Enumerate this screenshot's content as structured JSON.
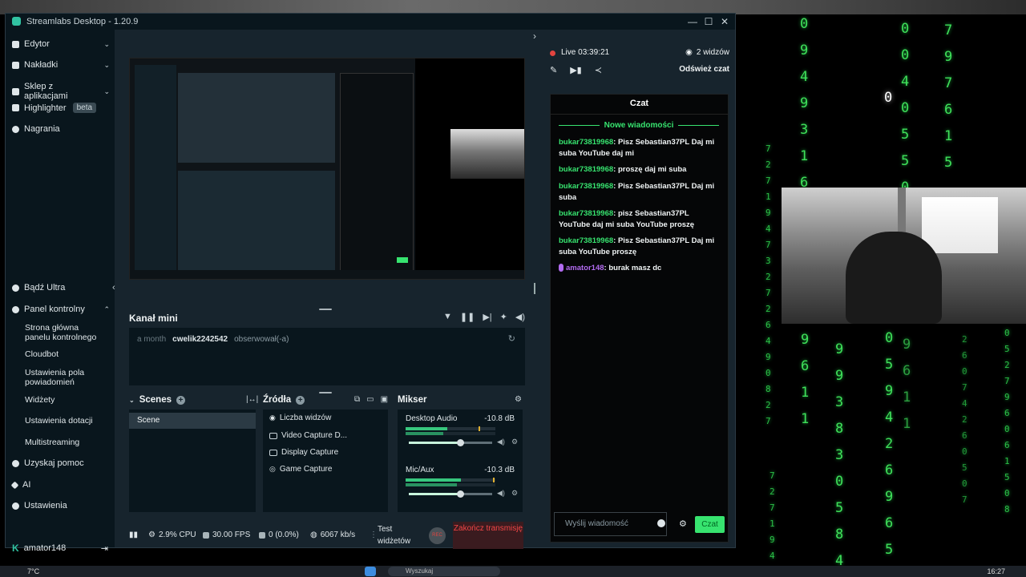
{
  "desktop": {
    "matrix_columns": [
      [
        "0",
        "9",
        "4",
        "9",
        "3",
        "1",
        "6"
      ],
      [
        "0",
        "0",
        "4",
        "0",
        "5",
        "5",
        "0"
      ],
      [
        "7",
        "9",
        "7",
        "6",
        "1",
        "5"
      ],
      [
        "0"
      ],
      [
        "9",
        "6",
        "1",
        "1"
      ],
      [
        "9",
        "9",
        "3",
        "8",
        "3",
        "0",
        "5",
        "8",
        "4"
      ],
      [
        "0",
        "5",
        "9",
        "4",
        "2",
        "6",
        "9",
        "6",
        "5"
      ],
      [
        "9",
        "6",
        "1",
        "1"
      ]
    ],
    "matrix_small_columns": [
      [
        "7",
        "2",
        "7",
        "1",
        "9",
        "4",
        "7",
        "3",
        "2",
        "7",
        "2",
        "6",
        "4",
        "9",
        "0",
        "8",
        "2",
        "7"
      ],
      [
        "7",
        "2",
        "7",
        "1",
        "9",
        "4"
      ],
      [
        "0",
        "5",
        "2",
        "7",
        "9",
        "6",
        "0",
        "6",
        "1",
        "5",
        "0",
        "8"
      ],
      [
        "2",
        "6",
        "0",
        "7",
        "4",
        "2",
        "6",
        "0",
        "5",
        "0",
        "7"
      ]
    ],
    "taskbar": {
      "weather": "7°C",
      "search_placeholder": "Wyszukaj",
      "clock": "16:27"
    }
  },
  "window": {
    "title": "Streamlabs Desktop - 1.20.9",
    "minimize": "—",
    "maximize": "☐",
    "close": "✕"
  },
  "sidebar": {
    "items": [
      {
        "label": "Edytor",
        "icon": "editor-icon"
      },
      {
        "label": "Nakładki",
        "icon": "overlay-icon"
      },
      {
        "label": "Sklep z aplikacjami",
        "icon": "app-store-icon"
      },
      {
        "label": "Highlighter",
        "badge": "beta",
        "icon": "highlighter-icon"
      },
      {
        "label": "Nagrania",
        "icon": "recordings-icon"
      }
    ],
    "ultra": "Bądź Ultra",
    "dashboard": "Panel kontrolny",
    "dashboard_sub": [
      "Strona główna panelu kontrolnego",
      "Cloudbot",
      "Ustawienia pola powiadomień",
      "Widżety",
      "Ustawienia dotacji",
      "Multistreaming"
    ],
    "help": "Uzyskaj pomoc",
    "ai": "AI",
    "settings": "Ustawienia",
    "user": "amator148"
  },
  "minifeed": {
    "title": "Kanał mini",
    "event": {
      "time": "a month",
      "user": "cwelik2242542",
      "action": "obserwował(-a)"
    }
  },
  "scenes": {
    "title": "Scenes",
    "items": [
      "Scene"
    ]
  },
  "sources": {
    "title": "Źródła",
    "items": [
      "Liczba widzów",
      "Video Capture D...",
      "Display Capture",
      "Game Capture"
    ]
  },
  "mixer": {
    "title": "Mikser",
    "channels": [
      {
        "name": "Desktop Audio",
        "db": "-10.8 dB",
        "level": 0.46,
        "volume": 0.62
      },
      {
        "name": "Mic/Aux",
        "db": "-10.3 dB",
        "level": 0.62,
        "volume": 0.62
      }
    ]
  },
  "footer": {
    "cpu": "2.9% CPU",
    "fps": "30.00 FPS",
    "dropped": "0 (0.0%)",
    "bitrate": "6067 kb/s",
    "test": "Test widżetów",
    "rec": "REC",
    "end": "Zakończ transmisję"
  },
  "live": {
    "status": "Live",
    "time": "03:39:21",
    "viewers": "2 widzów",
    "refresh": "Odśwież czat"
  },
  "chat": {
    "title": "Czat",
    "new_messages": "Nowe wiadomości",
    "messages": [
      {
        "user": "bukar73819968",
        "text": ": Pisz Sebastian37PL Daj mi suba YouTube daj mi"
      },
      {
        "user": "bukar73819968",
        "text": ": proszę daj mi suba"
      },
      {
        "user": "bukar73819968",
        "text": ": Pisz Sebastian37PL Daj mi suba"
      },
      {
        "user": "bukar73819968",
        "text": ": pisz Sebastian37PL YouTube daj mi suba YouTube proszę"
      },
      {
        "user": "bukar73819968",
        "text": ": Pisz Sebastian37PL Daj mi suba YouTube proszę"
      },
      {
        "user": "amator148",
        "text": ": burak masz dc"
      }
    ],
    "input_placeholder": "Wyślij wiadomość",
    "send": "Czat"
  }
}
